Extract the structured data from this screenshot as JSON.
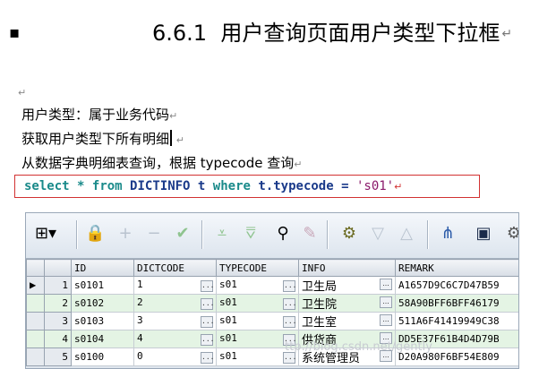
{
  "heading": {
    "number": "6.6.1",
    "title": "用户查询页面用户类型下拉框"
  },
  "paragraphs": {
    "line1": "用户类型：属于业务代码",
    "line2": "获取用户类型下所有明细",
    "line3": "从数据字典明细表查询，根据 typecode 查询"
  },
  "sql": {
    "kw_select": "select",
    "star": "*",
    "kw_from": "from",
    "table": "DICTINFO t",
    "kw_where": "where",
    "condition": "t.typecode =",
    "value": "'s01'"
  },
  "grid": {
    "columns": [
      "ID",
      "DICTCODE",
      "TYPECODE",
      "INFO",
      "REMARK"
    ],
    "rows": [
      {
        "num": "1",
        "id": "s0101",
        "dictcode": "1",
        "typecode": "s01",
        "info": "卫生局",
        "remark": "A1657D9C6C7D47B59"
      },
      {
        "num": "2",
        "id": "s0102",
        "dictcode": "2",
        "typecode": "s01",
        "info": "卫生院",
        "remark": "58A90BFF6BFF46179"
      },
      {
        "num": "3",
        "id": "s0103",
        "dictcode": "3",
        "typecode": "s01",
        "info": "卫生室",
        "remark": "511A6F41419949C38"
      },
      {
        "num": "4",
        "id": "s0104",
        "dictcode": "4",
        "typecode": "s01",
        "info": "供货商",
        "remark": "DD5E37F61B4D4D79B"
      },
      {
        "num": "5",
        "id": "s0100",
        "dictcode": "0",
        "typecode": "s01",
        "info": "系统管理员",
        "remark": "D20A980F6BF54E809"
      }
    ],
    "ellipsis": "..."
  },
  "watermark": "ttp://blog.csdn.net/gently",
  "icons": [
    "grid-menu-icon",
    "lock-icon",
    "add-icon",
    "remove-icon",
    "confirm-icon",
    "filter-down-icon",
    "filter-all-icon",
    "find-icon",
    "clear-icon",
    "query-icon",
    "sort-asc-icon",
    "sort-desc-icon",
    "tree-icon",
    "save-icon"
  ]
}
